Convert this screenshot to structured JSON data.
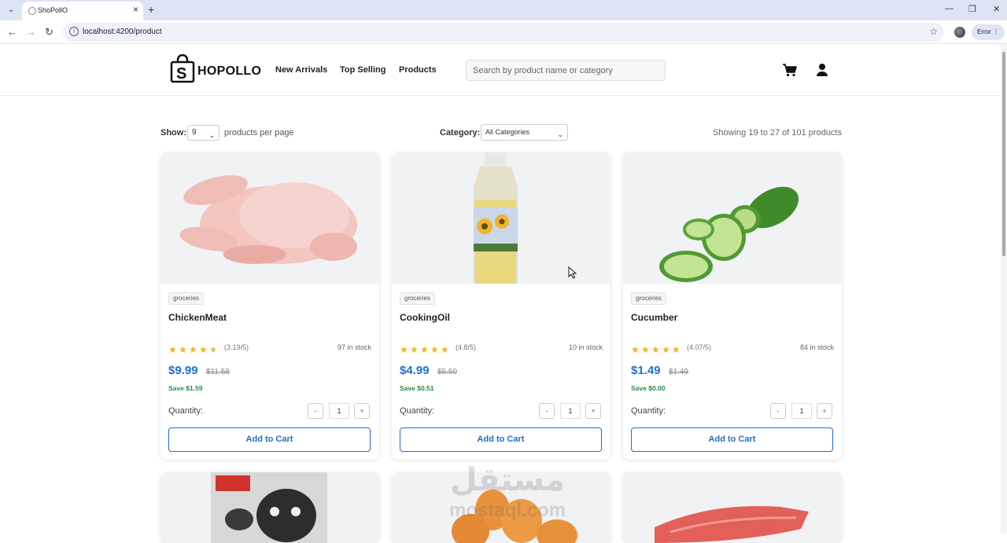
{
  "browser": {
    "tab_title": "ShoPollO",
    "url": "localhost:4200/product",
    "error_chip": "Error"
  },
  "header": {
    "logo_letter": "S",
    "logo_text": "HOPOLLO",
    "nav": [
      "New Arrivals",
      "Top Selling",
      "Products"
    ],
    "search_placeholder": "Search by product name or category"
  },
  "controls": {
    "show_label": "Show:",
    "per_page_value": "9",
    "per_page_text": "products per page",
    "category_label": "Category:",
    "category_value": "All Categories",
    "showing_text": "Showing 19 to 27 of 101 products"
  },
  "products": [
    {
      "category": "groceries",
      "name": "ChickenMeat",
      "rating_text": "(3.19/5)",
      "stock": "97 in stock",
      "price": "$9.99",
      "old_price": "$11.58",
      "save": "Save $1.59",
      "qty_label": "Quantity:",
      "qty": "1",
      "add_label": "Add to Cart",
      "stars": 3.19
    },
    {
      "category": "groceries",
      "name": "CookingOil",
      "rating_text": "(4.8/5)",
      "stock": "10 in stock",
      "price": "$4.99",
      "old_price": "$5.50",
      "save": "Save $0.51",
      "qty_label": "Quantity:",
      "qty": "1",
      "add_label": "Add to Cart",
      "stars": 4.8
    },
    {
      "category": "groceries",
      "name": "Cucumber",
      "rating_text": "(4.07/5)",
      "stock": "84 in stock",
      "price": "$1.49",
      "old_price": "$1.49",
      "save": "Save $0.00",
      "qty_label": "Quantity:",
      "qty": "1",
      "add_label": "Add to Cart",
      "stars": 4.07
    }
  ],
  "next_row_images": [
    "dog-food-bag",
    "eggs",
    "salmon-fillet"
  ],
  "watermark": {
    "line1": "مستقل",
    "line2": "mostaql.com"
  },
  "colors": {
    "price": "#1f6fcf",
    "save": "#2a8a4a",
    "star": "#f2b417"
  }
}
